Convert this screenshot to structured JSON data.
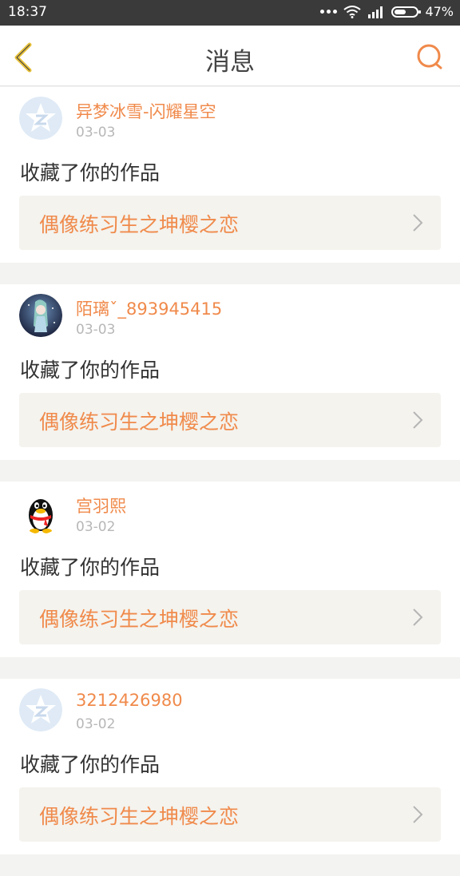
{
  "status": {
    "time": "18:37",
    "battery": "47%"
  },
  "header": {
    "title": "消息"
  },
  "messages": [
    {
      "name": "异梦冰雪-闪耀星空",
      "date": "03-03",
      "action": "收藏了你的作品",
      "work": "偶像练习生之坤樱之恋",
      "avatar": "qzone-star-avatar"
    },
    {
      "name": "陌璃ˇ_893945415",
      "date": "03-03",
      "action": "收藏了你的作品",
      "work": "偶像练习生之坤樱之恋",
      "avatar": "anime-girl-avatar"
    },
    {
      "name": "宫羽熙",
      "date": "03-02",
      "action": "收藏了你的作品",
      "work": "偶像练习生之坤樱之恋",
      "avatar": "qq-penguin-avatar"
    },
    {
      "name": "3212426980",
      "date": "03-02",
      "action": "收藏了你的作品",
      "work": "偶像练习生之坤樱之恋",
      "avatar": "qzone-star-avatar"
    }
  ],
  "colors": {
    "accent": "#f08a4b",
    "back_icon": "#e8c23a",
    "statusbar": "#3a3a3a"
  }
}
